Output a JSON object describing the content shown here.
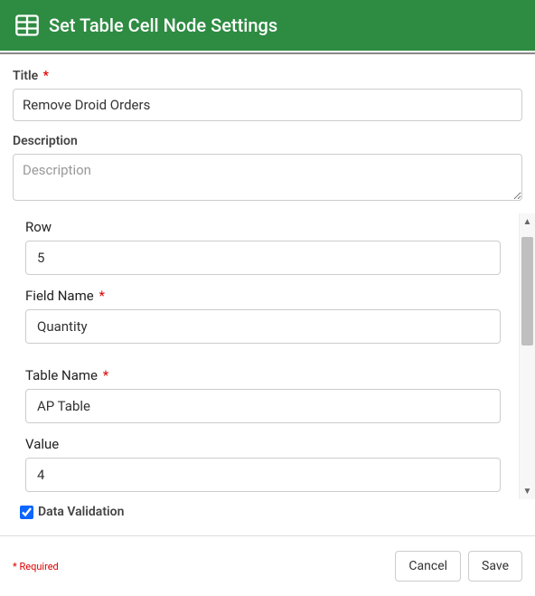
{
  "header": {
    "title": "Set Table Cell Node Settings"
  },
  "form": {
    "title": {
      "label": "Title",
      "value": "Remove Droid Orders",
      "required": true
    },
    "description": {
      "label": "Description",
      "placeholder": "Description",
      "value": ""
    },
    "row": {
      "label": "Row",
      "value": "5",
      "required": false
    },
    "fieldName": {
      "label": "Field Name",
      "value": "Quantity",
      "required": true
    },
    "tableName": {
      "label": "Table Name",
      "value": "AP Table",
      "required": true
    },
    "cellValue": {
      "label": "Value",
      "value": "4",
      "required": false
    },
    "dataValidation": {
      "label": "Data Validation",
      "checked": true
    }
  },
  "footer": {
    "requiredNote": "* Required",
    "cancelLabel": "Cancel",
    "saveLabel": "Save"
  },
  "asterisk": "*"
}
